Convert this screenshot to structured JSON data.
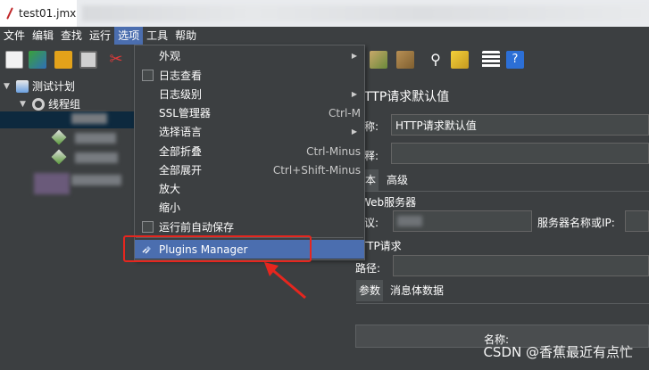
{
  "tab": {
    "title": "test01.jmx"
  },
  "menubar": [
    "文件",
    "编辑",
    "查找",
    "运行",
    "选项",
    "工具",
    "帮助"
  ],
  "tree": {
    "test_plan": "测试计划",
    "thread_group": "线程组"
  },
  "dropdown": {
    "items": [
      {
        "label": "外观",
        "shortcut": "",
        "submenu": true,
        "checkbox": false
      },
      {
        "label": "日志查看",
        "shortcut": "",
        "submenu": false,
        "checkbox": true
      },
      {
        "label": "日志级别",
        "shortcut": "",
        "submenu": true,
        "checkbox": false
      },
      {
        "label": "SSL管理器",
        "shortcut": "Ctrl-M",
        "submenu": false,
        "checkbox": false
      },
      {
        "label": "选择语言",
        "shortcut": "",
        "submenu": true,
        "checkbox": false
      },
      {
        "label": "全部折叠",
        "shortcut": "Ctrl-Minus",
        "submenu": false,
        "checkbox": false
      },
      {
        "label": "全部展开",
        "shortcut": "Ctrl+Shift-Minus",
        "submenu": false,
        "checkbox": false
      },
      {
        "label": "放大",
        "shortcut": "",
        "submenu": false,
        "checkbox": false
      },
      {
        "label": "缩小",
        "shortcut": "",
        "submenu": false,
        "checkbox": false
      },
      {
        "label": "运行前自动保存",
        "shortcut": "",
        "submenu": false,
        "checkbox": true
      }
    ],
    "plugins": "Plugins Manager"
  },
  "panel": {
    "title": "TTP请求默认值",
    "name_label": "称:",
    "name_value": "HTTP请求默认值",
    "comment_label": "释:",
    "tab_basic": "本",
    "tab_advanced": "高级",
    "web_server": "Web服务器",
    "protocol_label": "议:",
    "server_label": "服务器名称或IP:",
    "http_request": "TTP请求",
    "path_label": "路径:",
    "params_tab": "参数",
    "body_tab": "消息体数据",
    "name_col": "名称:"
  },
  "watermark": "CSDN @香蕉最近有点忙",
  "colors": {
    "menu_highlight": "#4b6eaf",
    "annotation": "#e6261e",
    "background": "#3c3f41"
  }
}
